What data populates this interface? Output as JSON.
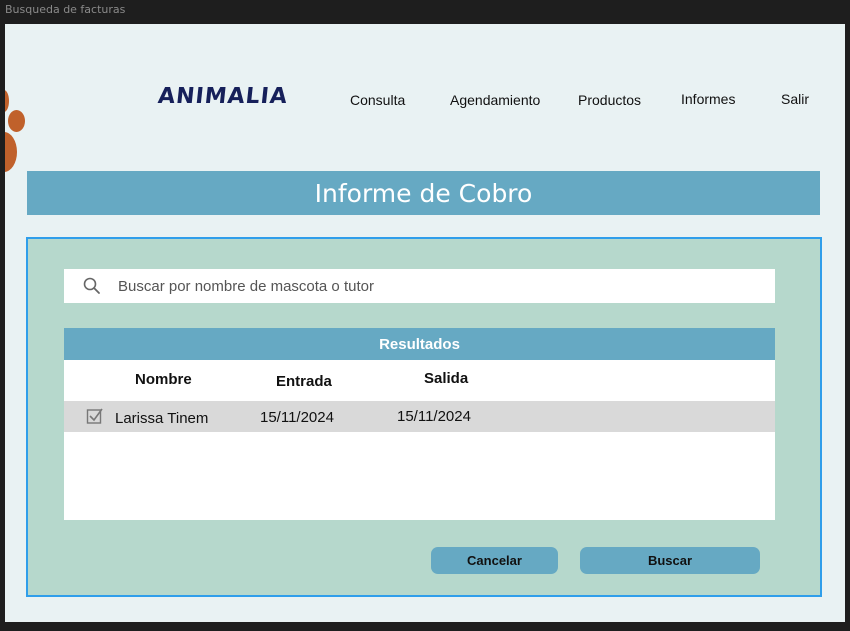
{
  "window": {
    "title": "Busqueda de facturas"
  },
  "brand": {
    "logo_text": "ANIMALIA",
    "logo_color": "#16205a",
    "accent_paw_color": "#c0612b"
  },
  "nav": {
    "items": [
      {
        "label": "Consulta"
      },
      {
        "label": "Agendamiento"
      },
      {
        "label": "Productos"
      },
      {
        "label": "Informes"
      },
      {
        "label": "Salir"
      }
    ]
  },
  "page": {
    "title": "Informe de Cobro"
  },
  "search": {
    "placeholder": "Buscar por nombre de mascota o tutor",
    "value": "",
    "icon": "search-icon"
  },
  "results": {
    "header": "Resultados",
    "columns": [
      "Nombre",
      "Entrada",
      "Salida"
    ],
    "rows": [
      {
        "checked": true,
        "nombre": "Larissa Tinem",
        "entrada": "15/11/2024",
        "salida": "15/11/2024"
      }
    ]
  },
  "actions": {
    "cancel_label": "Cancelar",
    "search_label": "Buscar"
  },
  "colors": {
    "primary": "#66a9c3",
    "panel": "#b6d8cc",
    "panel_border": "#2f9eea",
    "background": "#e9f2f3"
  }
}
